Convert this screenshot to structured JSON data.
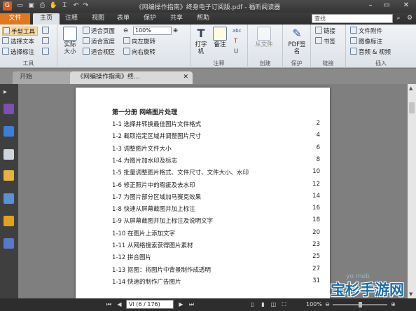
{
  "window": {
    "title": "《网编操作指南》终身电子订阅版.pdf - 福昕阅读器",
    "quick_access": [
      "save-icon",
      "print-icon",
      "undo-icon",
      "redo-icon"
    ]
  },
  "ribbon_tabs": [
    "文件",
    "主页",
    "注释",
    "视图",
    "表单",
    "保护",
    "共享",
    "帮助"
  ],
  "search": {
    "placeholder": "查找"
  },
  "ribbon": {
    "tools": {
      "label": "工具",
      "items": [
        "手型工具",
        "选择文本",
        "选择标注"
      ]
    },
    "view": {
      "actual_size": "实际大小",
      "fit_page": "适合页面",
      "fit_width": "适合宽度",
      "fit_visible": "适合视区",
      "zoom_value": "100%",
      "rotate_left": "向左旋转",
      "rotate_right": "向右旋转"
    },
    "comment": {
      "label": "注释",
      "typewriter": "打字机",
      "note": "备注"
    },
    "create": {
      "label": "创建",
      "from_file": "从文件"
    },
    "protect": {
      "label": "保护",
      "pdf_sign": "PDF签名"
    },
    "links": {
      "label": "链接",
      "link": "链接",
      "bookmark": "书签"
    },
    "insert": {
      "label": "插入",
      "attachment": "文件附件",
      "image": "图像标注",
      "av": "音频 & 视频"
    }
  },
  "doc_tabs": [
    "开始",
    "《网编操作指南》终..."
  ],
  "document": {
    "heading": "第一分册 网络图片处理",
    "toc": [
      {
        "title": "1-1 选择并转换最佳图片文件格式",
        "page": "2"
      },
      {
        "title": "1-2 截取指定区域并调整图片尺寸",
        "page": "4"
      },
      {
        "title": "1-3 调整图片文件大小",
        "page": "6"
      },
      {
        "title": "1-4 为图片加水印及标志",
        "page": "8"
      },
      {
        "title": "1-5 批量调整图片格式、文件尺寸、文件大小、水印",
        "page": "10"
      },
      {
        "title": "1-6 修正照片中的暇疵及去水印",
        "page": "12"
      },
      {
        "title": "1-7 为图片部分区域加马赛克效果",
        "page": "14"
      },
      {
        "title": "1-8 快速从屏幕截图并加上标注",
        "page": "16"
      },
      {
        "title": "1-9 从屏幕截图并加上标注及说明文字",
        "page": "18"
      },
      {
        "title": "1-10 在图片上添加文字",
        "page": "20"
      },
      {
        "title": "1-11 从网络搜索获得图片素材",
        "page": "23"
      },
      {
        "title": "1-12 拼合图片",
        "page": "25"
      },
      {
        "title": "1-13 抠图：将图片中背景制作成透明",
        "page": "27"
      },
      {
        "title": "1-14 快速的制作广告图片",
        "page": "31"
      }
    ]
  },
  "status": {
    "page_indicator": "VI (6 / 176)",
    "zoom": "100%"
  },
  "watermark": {
    "text": "宝杉手游网",
    "small": "yo mob"
  }
}
